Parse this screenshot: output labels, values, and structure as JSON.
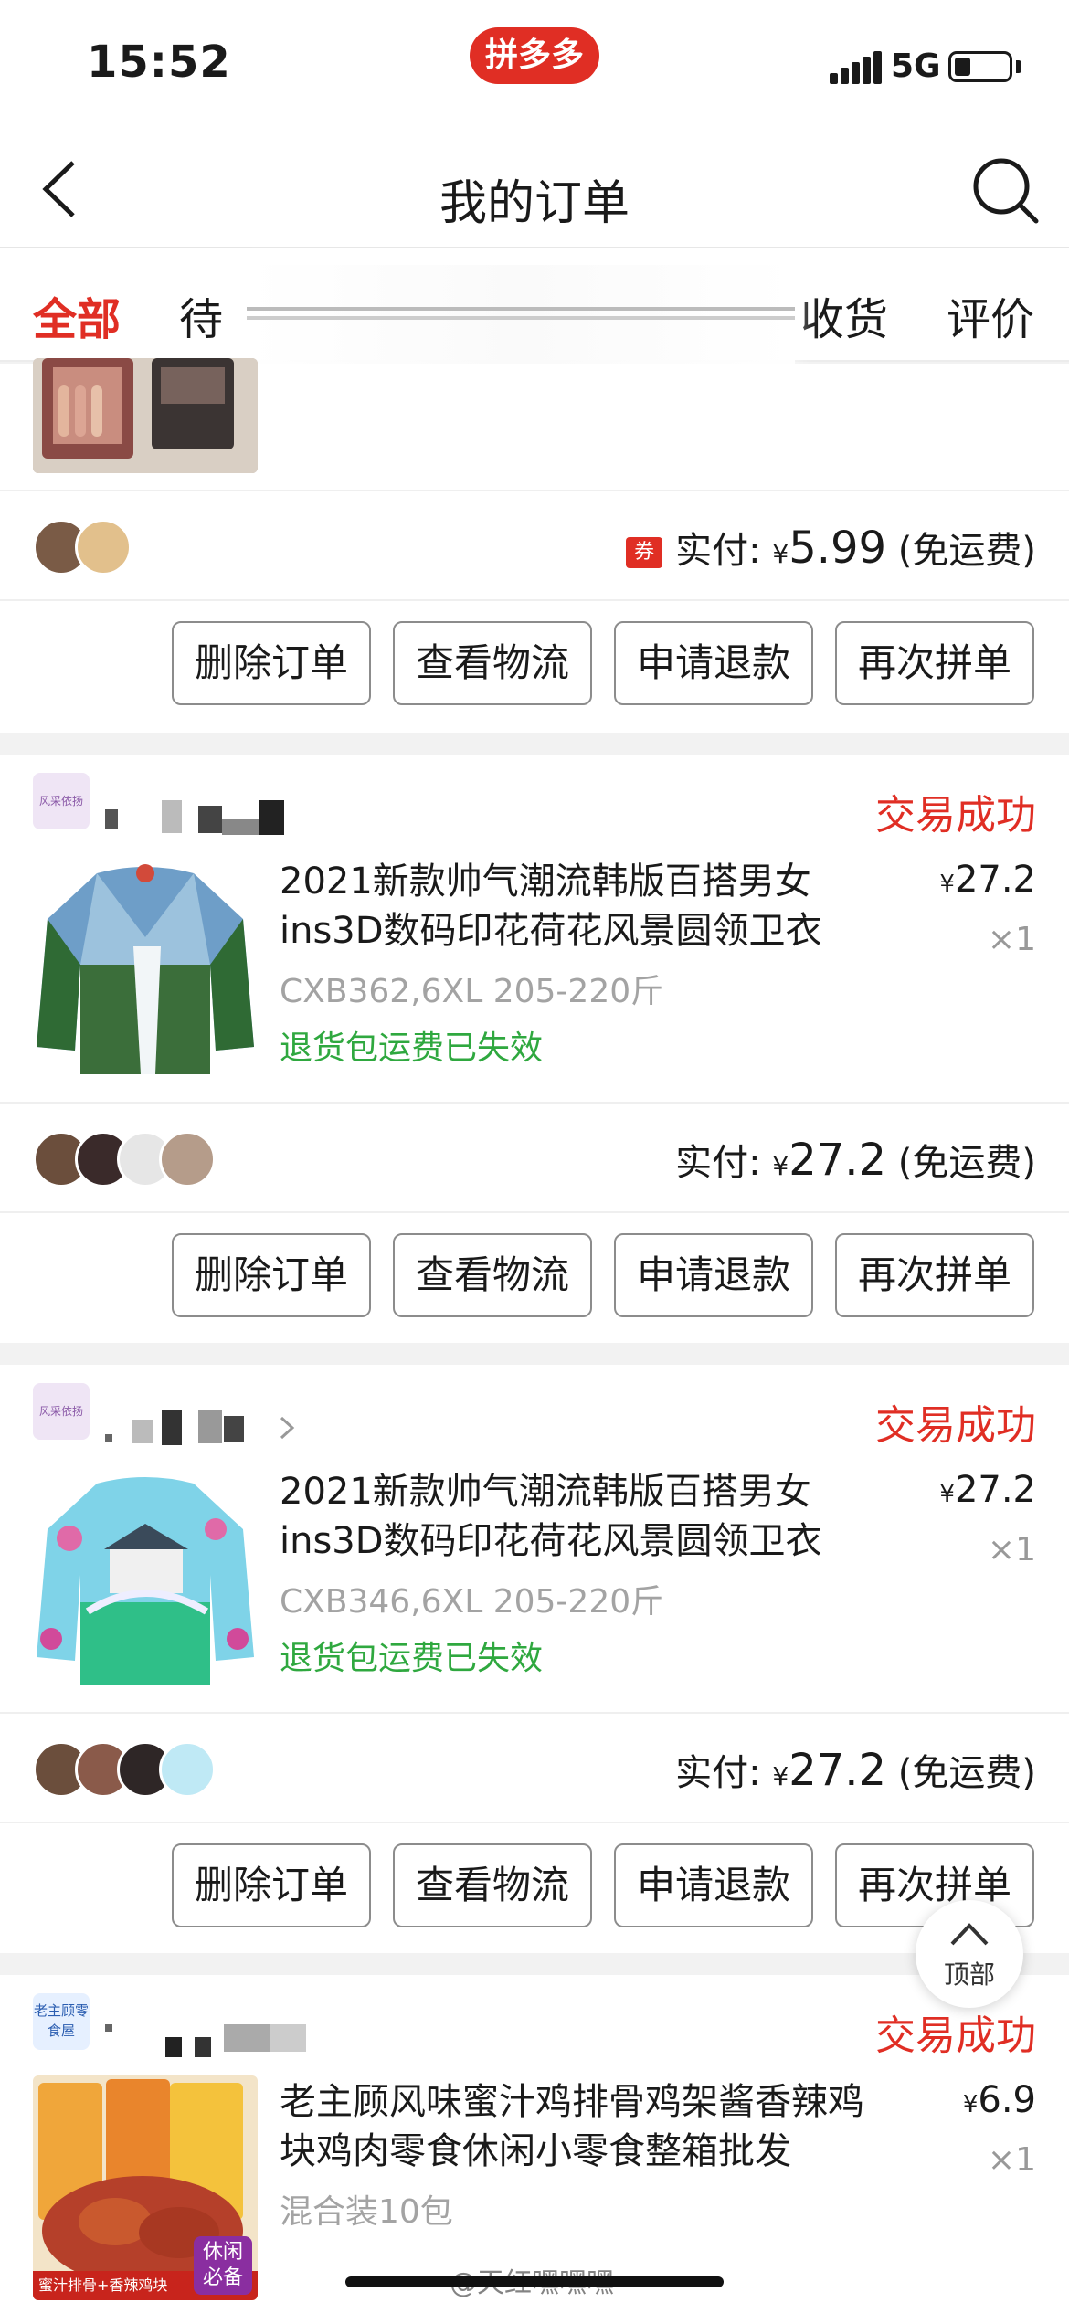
{
  "status_bar": {
    "time": "15:52",
    "app_logo": "拼多多",
    "network": "5G",
    "battery_level": 0.3
  },
  "nav": {
    "title": "我的订单",
    "back_icon": "chevron-left-icon",
    "search_icon": "search-icon"
  },
  "tabs": [
    {
      "label": "全部",
      "active": true
    },
    {
      "label": "待"
    },
    {
      "label": "收货"
    },
    {
      "label": "评价"
    }
  ],
  "orders": [
    {
      "pay_label": "实付:",
      "currency": "¥",
      "amount": "5.99",
      "shipping": "(免运费)",
      "coupon": "券",
      "buttons": [
        "删除订单",
        "查看物流",
        "申请退款",
        "再次拼单"
      ]
    },
    {
      "shop_logo_text": "风采依扬",
      "status": "交易成功",
      "title": "2021新款帅气潮流韩版百搭男女ins3D数码印花荷花风景圆领卫衣",
      "price_currency": "¥",
      "price": "27.2",
      "qty": "×1",
      "sku": "CXB362,6XL 205-220斤",
      "note": "退货包运费已失效",
      "pay_label": "实付:",
      "currency": "¥",
      "amount": "27.2",
      "shipping": "(免运费)",
      "buttons": [
        "删除订单",
        "查看物流",
        "申请退款",
        "再次拼单"
      ]
    },
    {
      "shop_logo_text": "风采依扬",
      "status": "交易成功",
      "title": "2021新款帅气潮流韩版百搭男女ins3D数码印花荷花风景圆领卫衣",
      "price_currency": "¥",
      "price": "27.2",
      "qty": "×1",
      "sku": "CXB346,6XL 205-220斤",
      "note": "退货包运费已失效",
      "pay_label": "实付:",
      "currency": "¥",
      "amount": "27.2",
      "shipping": "(免运费)",
      "buttons": [
        "删除订单",
        "查看物流",
        "申请退款",
        "再次拼单"
      ]
    },
    {
      "shop_logo_text": "老主顾零食屋",
      "status": "交易成功",
      "title": "老主顾风味蜜汁鸡排骨鸡架酱香辣鸡块鸡肉零食休闲小零食整箱批发",
      "price_currency": "¥",
      "price": "6.9",
      "qty": "×1",
      "sku": "混合装10包",
      "thumb_badge": "休闲必备",
      "thumb_caption": "蜜汁排骨+香辣鸡块"
    }
  ],
  "back_to_top": "顶部",
  "watermark": "@天红嘿嘿嘿",
  "colors": {
    "brand": "#e02e24",
    "success_green": "#2fa83f",
    "muted": "#a3a3a3"
  }
}
